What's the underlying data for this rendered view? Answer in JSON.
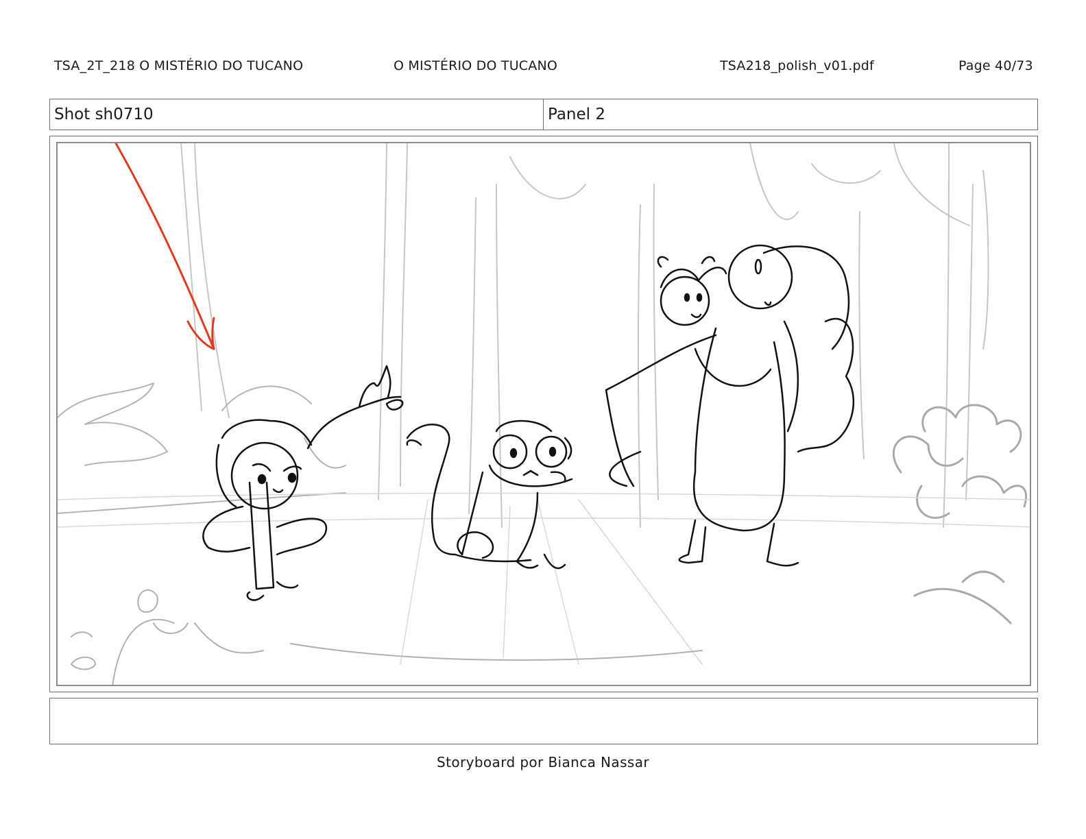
{
  "header": {
    "project": "TSA_2T_218  O MISTÉRIO DO TUCANO",
    "title": "O MISTÉRIO DO TUCANO",
    "filename": "TSA218_polish_v01.pdf",
    "page": "Page 40/73"
  },
  "shot": {
    "shot_label": "Shot sh0710",
    "panel_label": "Panel 2"
  },
  "panel": {
    "notes": "",
    "arrow_color": "#e23a1e"
  },
  "footer": {
    "credit": "Storyboard por Bianca Nassar"
  }
}
